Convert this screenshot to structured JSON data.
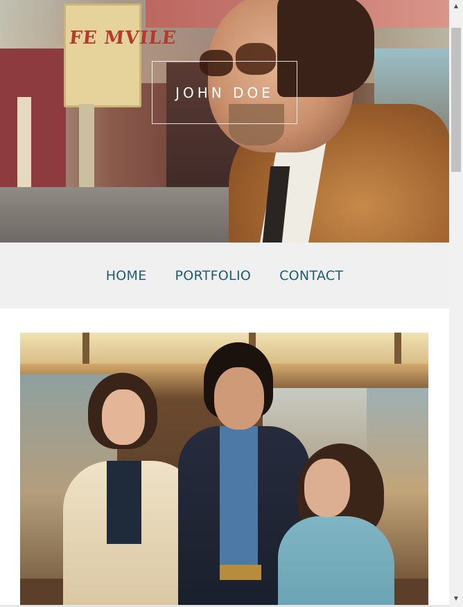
{
  "header": {
    "title": "JOHN DOE",
    "sign_text": "FE MVILE"
  },
  "nav": {
    "items": [
      {
        "label": "HOME"
      },
      {
        "label": "PORTFOLIO"
      },
      {
        "label": "CONTACT"
      }
    ]
  },
  "colors": {
    "nav_link": "#1d5c73",
    "page_bg": "#f0f0f0",
    "content_bg": "#ffffff"
  },
  "scrollbar": {
    "up_icon": "triangle-up-icon",
    "down_icon": "triangle-down-icon"
  }
}
